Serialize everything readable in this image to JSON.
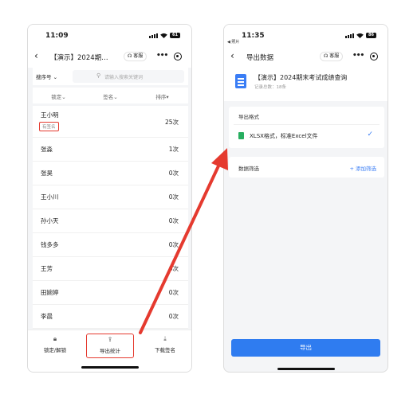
{
  "left": {
    "status_time": "11:09",
    "battery": "61",
    "nav_title": "【演示】2024期…",
    "kefu_label": "客服",
    "sort_label": "搜序号",
    "search_placeholder": "请输入搜索关键词",
    "columns": [
      "锁定",
      "签名",
      "排序"
    ],
    "rows": [
      {
        "name": "王小明",
        "badge": "有签名",
        "count": "25次"
      },
      {
        "name": "张淼",
        "count": "1次"
      },
      {
        "name": "张昊",
        "count": "0次"
      },
      {
        "name": "王小川",
        "count": "0次"
      },
      {
        "name": "孙小天",
        "count": "0次"
      },
      {
        "name": "钱多多",
        "count": "0次"
      },
      {
        "name": "王芳",
        "count": "0次"
      },
      {
        "name": "田婉婷",
        "count": "0次"
      },
      {
        "name": "李晨",
        "count": "0次"
      }
    ],
    "tabs": [
      {
        "icon": "lock-icon",
        "label": "锁定/解锁"
      },
      {
        "icon": "export-icon",
        "label": "导出统计"
      },
      {
        "icon": "download-icon",
        "label": "下载签名"
      }
    ]
  },
  "right": {
    "status_time": "11:35",
    "back_app": "◀ 照片",
    "battery": "86",
    "nav_title": "导出数据",
    "kefu_label": "客服",
    "doc_title": "【演示】2024期末考试成绩查询",
    "doc_sub": "记录总数：18条",
    "format_section": "导出格式",
    "format_option": "XLSX格式，标准Excel文件",
    "filter_section": "数据筛选",
    "add_filter": "+ 添加筛选",
    "export_button": "导出"
  },
  "colors": {
    "highlight": "#e53a2f",
    "accent": "#2f7cf0"
  }
}
